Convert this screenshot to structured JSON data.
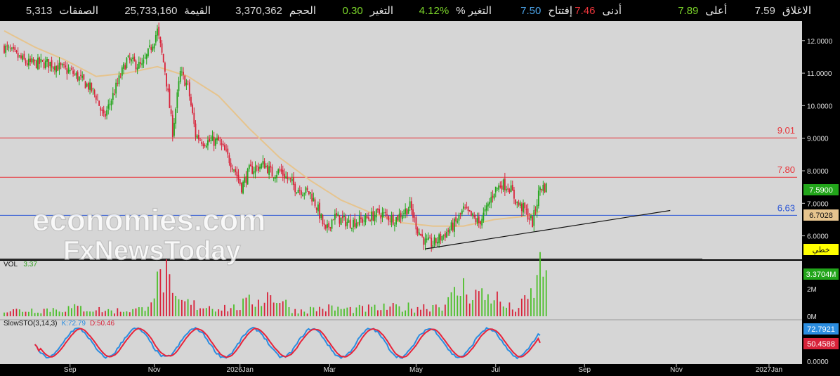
{
  "stats": [
    {
      "label": "الاغلاق",
      "value": "7.59",
      "color": "#d8d8d8"
    },
    {
      "label": "أعلى",
      "value": "7.89",
      "color": "#7cd62a"
    },
    {
      "label": "أدنى",
      "value": "7.46",
      "color": "#e8343a"
    },
    {
      "label": "إفتتاح",
      "value": "7.50",
      "color": "#4ba3e8"
    },
    {
      "label": "التغير %",
      "value": "4.12%",
      "color": "#7cd62a"
    },
    {
      "label": "التغير",
      "value": "0.30",
      "color": "#7cd62a"
    },
    {
      "label": "الحجم",
      "value": "3,370,362",
      "color": "#d8d8d8"
    },
    {
      "label": "القيمة",
      "value": "25,733,160",
      "color": "#d8d8d8"
    },
    {
      "label": "الصفقات",
      "value": "5,313",
      "color": "#d8d8d8"
    }
  ],
  "colors": {
    "background": "#d6d6d6",
    "up": "#22a51a",
    "down": "#d8233a",
    "ma": "#e6c48e",
    "resistance": "#e8343a",
    "support": "#2b56d6",
    "vol_up": "#4cbf2a",
    "vol_down": "#d8233a",
    "k_line": "#2b8de0",
    "d_line": "#e8233a",
    "trend": "#111111"
  },
  "watermark": {
    "line1": "economies.com",
    "line2": "FxNewsToday"
  },
  "price_badges": {
    "last": "7.5900",
    "ma": "6.7028",
    "trend_tag": "خطي"
  },
  "vol_label": {
    "name": "VOL",
    "value": "3.37"
  },
  "vol_badge": "3.3704M",
  "sto_label": {
    "name": "SlowSTO(3,14,3)",
    "k": "K:72.79",
    "d": "D:50.46"
  },
  "sto_badges": {
    "k": "72.7921",
    "d": "50.4588"
  },
  "chart_data": {
    "type": "candlestick",
    "x_ticks": [
      "Sep",
      "Nov",
      "2026Jan",
      "Mar",
      "May",
      "Jul",
      "Sep",
      "Nov",
      "2027Jan"
    ],
    "y_ticks": [
      "12.0000",
      "11.0000",
      "10.0000",
      "9.0000",
      "8.0000",
      "7.0000",
      "6.0000"
    ],
    "ylim": [
      5.3,
      12.6
    ],
    "vol_ticks": [
      "2M",
      "0M"
    ],
    "vol_max": 3.6,
    "sto_ticks": [
      "0.0000"
    ],
    "horizontal_lines": [
      {
        "label": "9.01",
        "value": 9.01,
        "color": "#e8343a"
      },
      {
        "label": "7.80",
        "value": 7.8,
        "color": "#e8343a"
      },
      {
        "label": "6.63",
        "value": 6.63,
        "color": "#2b56d6"
      }
    ],
    "trendline": {
      "from": {
        "week": 55,
        "value": 5.6
      },
      "to": {
        "week": 87,
        "value": 6.78
      }
    },
    "price_keypoints": [
      [
        0,
        11.8
      ],
      [
        3,
        11.3
      ],
      [
        6,
        11.3
      ],
      [
        9,
        11.0
      ],
      [
        11,
        10.6
      ],
      [
        12,
        10.3
      ],
      [
        13,
        9.6
      ],
      [
        14,
        10.2
      ],
      [
        16,
        11.4
      ],
      [
        18,
        11.2
      ],
      [
        19,
        11.7
      ],
      [
        20,
        12.3
      ],
      [
        21,
        11.1
      ],
      [
        22,
        9.2
      ],
      [
        23,
        11.0
      ],
      [
        24,
        10.6
      ],
      [
        25,
        9.1
      ],
      [
        26,
        8.9
      ],
      [
        28,
        8.9
      ],
      [
        30,
        8.1
      ],
      [
        31,
        7.5
      ],
      [
        32,
        8.0
      ],
      [
        34,
        8.2
      ],
      [
        35,
        7.9
      ],
      [
        36,
        8.0
      ],
      [
        38,
        7.5
      ],
      [
        40,
        7.3
      ],
      [
        41,
        6.8
      ],
      [
        42,
        6.1
      ],
      [
        43,
        6.6
      ],
      [
        45,
        6.4
      ],
      [
        47,
        6.5
      ],
      [
        49,
        6.7
      ],
      [
        51,
        6.5
      ],
      [
        53,
        6.9
      ],
      [
        54,
        6.2
      ],
      [
        55,
        5.8
      ],
      [
        56,
        5.75
      ],
      [
        58,
        6.15
      ],
      [
        59,
        6.4
      ],
      [
        60,
        6.8
      ],
      [
        62,
        6.4
      ],
      [
        63,
        6.8
      ],
      [
        64,
        7.4
      ],
      [
        65,
        7.6
      ],
      [
        66,
        7.5
      ],
      [
        67,
        7.0
      ],
      [
        68,
        6.8
      ],
      [
        69,
        6.4
      ],
      [
        70,
        7.5
      ]
    ],
    "ma_keypoints": [
      [
        0,
        12.3
      ],
      [
        4,
        11.8
      ],
      [
        8,
        11.4
      ],
      [
        12,
        10.9
      ],
      [
        16,
        11.0
      ],
      [
        20,
        11.2
      ],
      [
        24,
        10.9
      ],
      [
        28,
        10.3
      ],
      [
        32,
        9.3
      ],
      [
        36,
        8.4
      ],
      [
        40,
        7.7
      ],
      [
        44,
        7.1
      ],
      [
        48,
        6.7
      ],
      [
        52,
        6.4
      ],
      [
        56,
        6.3
      ],
      [
        60,
        6.3
      ],
      [
        64,
        6.5
      ],
      [
        68,
        6.6
      ],
      [
        70,
        6.75
      ]
    ],
    "volume_keypoints": [
      [
        0,
        0.4
      ],
      [
        5,
        0.5
      ],
      [
        10,
        0.6
      ],
      [
        14,
        0.4
      ],
      [
        18,
        0.5
      ],
      [
        19,
        1.5
      ],
      [
        20,
        2.2
      ],
      [
        21,
        3.3
      ],
      [
        22,
        1.1
      ],
      [
        25,
        0.8
      ],
      [
        30,
        0.6
      ],
      [
        35,
        1.6
      ],
      [
        38,
        0.4
      ],
      [
        42,
        0.6
      ],
      [
        45,
        0.5
      ],
      [
        50,
        0.6
      ],
      [
        55,
        0.7
      ],
      [
        58,
        1.0
      ],
      [
        59,
        1.7
      ],
      [
        60,
        2.0
      ],
      [
        63,
        1.4
      ],
      [
        64,
        1.6
      ],
      [
        65,
        0.8
      ],
      [
        67,
        0.5
      ],
      [
        69,
        1.6
      ],
      [
        70,
        3.37
      ]
    ],
    "sto_k_last": 72.79,
    "sto_d_last": 50.46
  }
}
